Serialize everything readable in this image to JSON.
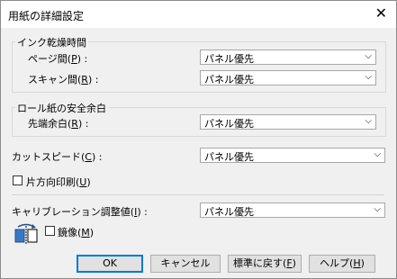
{
  "window": {
    "title": "用紙の詳細設定",
    "close_glyph": "✕"
  },
  "ink_dry": {
    "group_label": "インク乾燥時間",
    "page_label": "ページ間(",
    "page_key": "P",
    "page_suffix": ") :",
    "page_value": "パネル優先",
    "scan_label": "スキャン間(",
    "scan_key": "R",
    "scan_suffix": ") :",
    "scan_value": "パネル優先"
  },
  "roll_margin": {
    "group_label": "ロール紙の安全余白",
    "lead_label": "先端余白(",
    "lead_key": "R",
    "lead_suffix": ") :",
    "lead_value": "パネル優先"
  },
  "cut": {
    "label": "カットスピード(",
    "key": "C",
    "suffix": ") :",
    "value": "パネル優先"
  },
  "unidirectional": {
    "label": "片方向印刷(",
    "key": "U",
    "suffix": ")"
  },
  "calibration": {
    "label": "キャリブレーション調整値(",
    "key": "I",
    "suffix": ") :",
    "value": "パネル優先"
  },
  "mirror": {
    "label": "鏡像(",
    "key": "M",
    "suffix": ")"
  },
  "buttons": {
    "ok": "OK",
    "cancel": "キャンセル",
    "reset_prefix": "標準に戻す(",
    "reset_key": "F",
    "reset_suffix": ")",
    "help_prefix": "ヘルプ(",
    "help_key": "H",
    "help_suffix": ")"
  },
  "icons": {
    "close": "close-icon",
    "chevron": "chevron-down-icon",
    "mirror": "mirror-icon"
  },
  "colors": {
    "default_button_border": "#0078d7",
    "window_bg": "#f0f0f0"
  }
}
